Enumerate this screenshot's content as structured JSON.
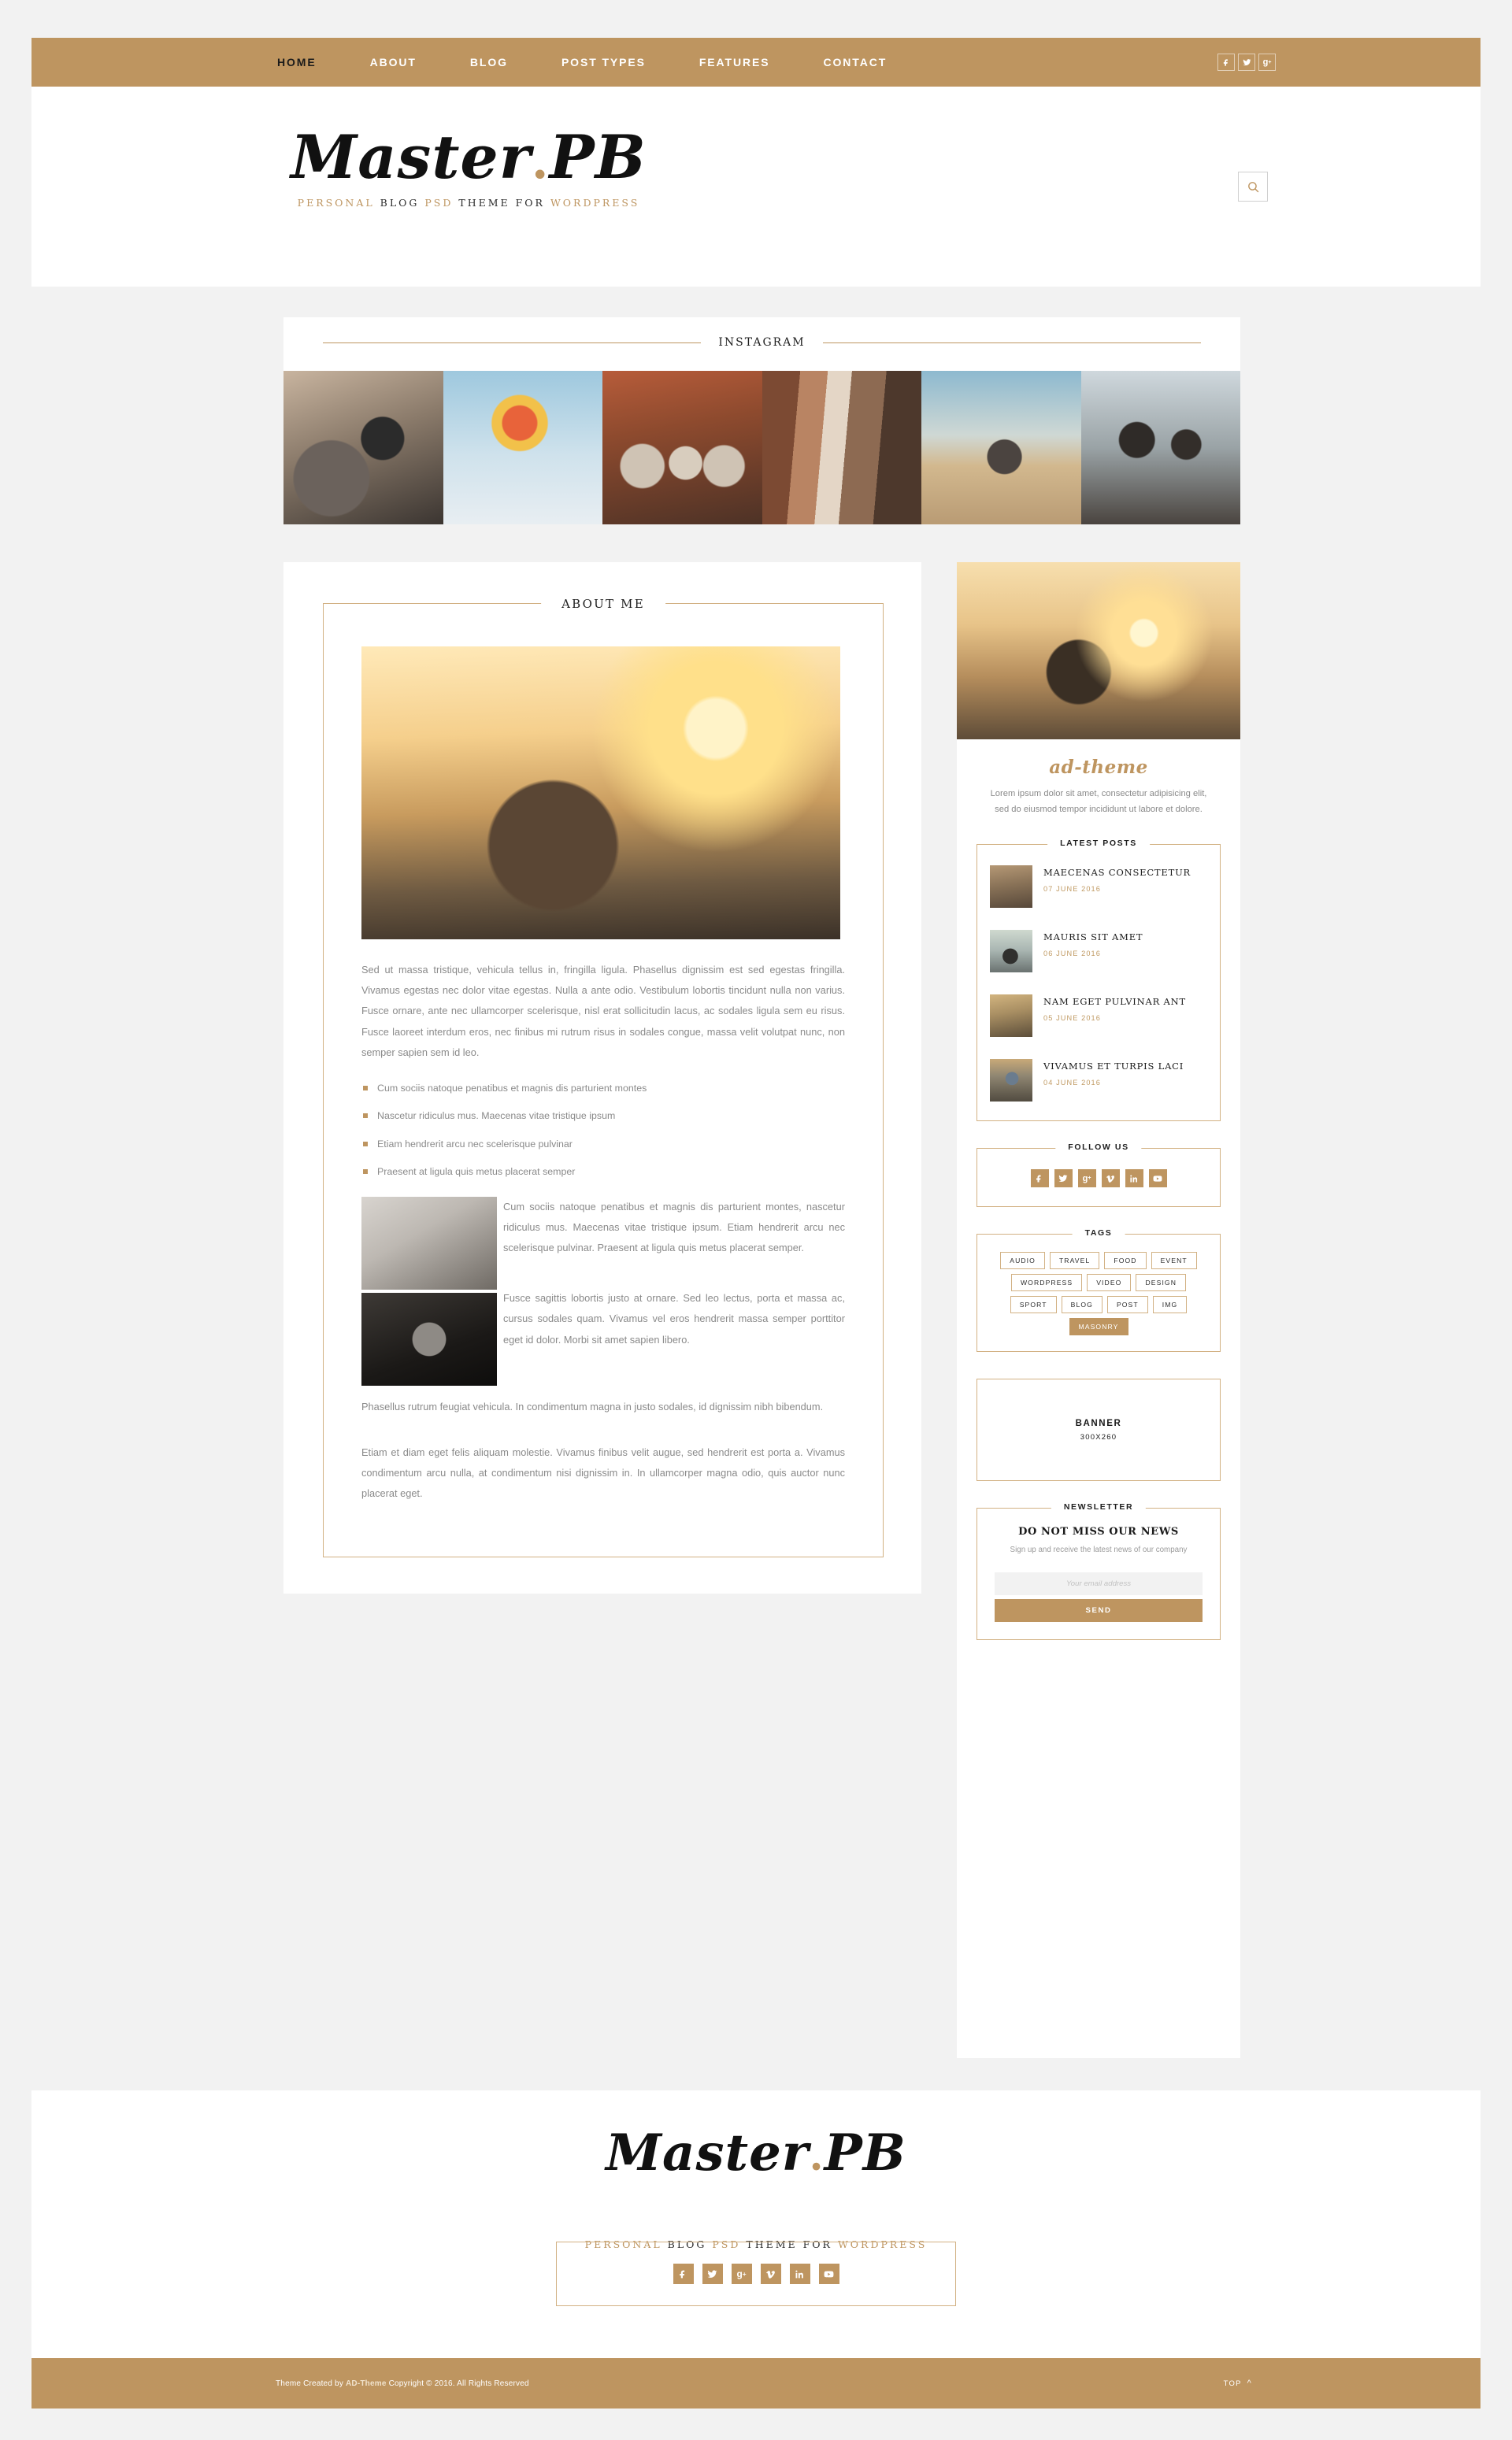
{
  "brand": {
    "name_script": "Master",
    "name_dot": ".",
    "name_suffix": "PB",
    "tagline_parts": [
      "PERSONAL",
      "BLOG",
      "PSD",
      "THEME FOR",
      "WORDPRESS"
    ],
    "accent_color": "#be9560"
  },
  "nav": {
    "items": [
      {
        "label": "HOME",
        "active": true
      },
      {
        "label": "ABOUT",
        "active": false
      },
      {
        "label": "BLOG",
        "active": false
      },
      {
        "label": "POST TYPES",
        "active": false
      },
      {
        "label": "FEATURES",
        "active": false
      },
      {
        "label": "CONTACT",
        "active": false
      }
    ],
    "social": [
      "facebook",
      "twitter",
      "google-plus"
    ]
  },
  "search": {
    "icon": "search-icon"
  },
  "instagram": {
    "title": "INSTAGRAM",
    "photo_count": 6
  },
  "about": {
    "title": "ABOUT ME",
    "paragraph": "Sed ut massa tristique, vehicula tellus in, fringilla ligula. Phasellus dignissim est sed egestas fringilla. Vivamus egestas nec dolor vitae egestas. Nulla a ante odio. Vestibulum lobortis tincidunt nulla non varius. Fusce ornare, ante nec ullamcorper scelerisque, nisl erat sollicitudin lacus, ac sodales ligula sem eu risus. Fusce laoreet interdum eros, nec finibus mi rutrum risus in sodales congue, massa velit volutpat nunc, non semper sapien sem id leo.",
    "bullets": [
      "Cum sociis natoque penatibus et magnis dis parturient montes",
      "Nascetur ridiculus mus. Maecenas vitae tristique ipsum",
      "Etiam hendrerit arcu nec scelerisque pulvinar",
      "Praesent at ligula quis metus placerat semper"
    ],
    "media_paragraph_1": "Cum sociis natoque penatibus et magnis dis parturient montes, nascetur ridiculus mus. Maecenas vitae tristique ipsum. Etiam hendrerit arcu nec scelerisque pulvinar. Praesent at ligula quis metus placerat semper.",
    "media_paragraph_2": "Fusce sagittis lobortis justo at ornare. Sed leo lectus, porta et massa ac, cursus sodales quam. Vivamus vel eros hendrerit massa semper porttitor eget id dolor. Morbi sit amet sapien libero.",
    "paragraph_3": "Phasellus rutrum feugiat vehicula. In condimentum magna in justo sodales, id dignissim nibh bibendum.",
    "paragraph_4": "Etiam et diam eget felis aliquam molestie. Vivamus finibus velit augue, sed hendrerit est porta a. Vivamus condimentum arcu nulla, at condimentum nisi dignissim in. In ullamcorper magna odio, quis auctor nunc placerat eget."
  },
  "sidebar": {
    "ad": {
      "name": "ad-theme",
      "description": "Lorem ipsum dolor sit amet, consectetur adipisicing elit, sed do eiusmod tempor incididunt ut labore et dolore."
    },
    "latest_posts": {
      "title": "LATEST POSTS",
      "items": [
        {
          "title": "MAECENAS CONSECTETUR",
          "date": "07 JUNE 2016"
        },
        {
          "title": "MAURIS SIT AMET",
          "date": "06 JUNE 2016"
        },
        {
          "title": "NAM EGET PULVINAR ANT",
          "date": "05 JUNE 2016"
        },
        {
          "title": "VIVAMUS ET TURPIS LACI",
          "date": "04 JUNE 2016"
        }
      ]
    },
    "follow": {
      "title": "FOLLOW US",
      "icons": [
        "facebook",
        "twitter",
        "google-plus",
        "vimeo",
        "linkedin",
        "youtube"
      ]
    },
    "tags": {
      "title": "TAGS",
      "items": [
        {
          "label": "AUDIO",
          "active": false
        },
        {
          "label": "TRAVEL",
          "active": false
        },
        {
          "label": "FOOD",
          "active": false
        },
        {
          "label": "EVENT",
          "active": false
        },
        {
          "label": "WORDPRESS",
          "active": false
        },
        {
          "label": "VIDEO",
          "active": false
        },
        {
          "label": "DESIGN",
          "active": false
        },
        {
          "label": "SPORT",
          "active": false
        },
        {
          "label": "BLOG",
          "active": false
        },
        {
          "label": "POST",
          "active": false
        },
        {
          "label": "IMG",
          "active": false
        },
        {
          "label": "MASONRY",
          "active": true
        }
      ]
    },
    "banner": {
      "title": "BANNER",
      "size": "300X260"
    },
    "newsletter": {
      "title": "NEWSLETTER",
      "heading": "DO NOT MISS OUR NEWS",
      "subtext": "Sign up and receive the latest news of our company",
      "placeholder": "Your email address",
      "button": "SEND"
    }
  },
  "footer": {
    "social": [
      "facebook",
      "twitter",
      "google-plus",
      "vimeo",
      "linkedin",
      "youtube"
    ],
    "copyright_pre": "Theme Created by ",
    "copyright_brand": "AD-Theme",
    "copyright_post": " Copyright © 2016. All Rights Reserved",
    "top_label": "TOP"
  }
}
